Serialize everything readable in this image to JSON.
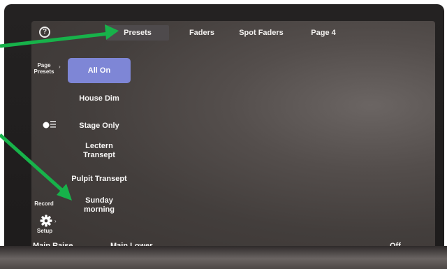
{
  "tabs": [
    "Presets",
    "Faders",
    "Spot Faders",
    "Page 4"
  ],
  "sidebar": {
    "page_presets": "Page\nPresets",
    "record": "Record",
    "setup": "Setup"
  },
  "presets": [
    "All On",
    "House Dim",
    "Stage Only",
    "Lectern\nTransept",
    "Pulpit Transept",
    "Sunday\nmorning"
  ],
  "bottom": {
    "main_raise": "Main Raise",
    "main_lower": "Main Lower",
    "off": "Off"
  },
  "colors": {
    "active_preset": "#7e86d6",
    "arrow": "#17b24a"
  },
  "icons": [
    "help-icon",
    "chevron-right-icon",
    "bulb-sliders-icon",
    "gear-icon"
  ]
}
